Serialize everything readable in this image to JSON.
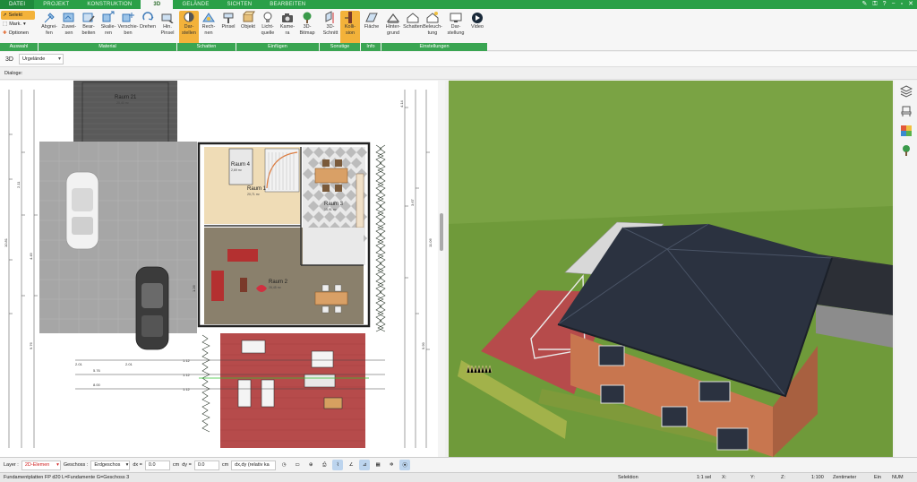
{
  "menu": {
    "tabs": [
      "DATEI",
      "PROJEKT",
      "KONSTRUKTION",
      "3D",
      "GELÄNDE",
      "SICHTEN",
      "BEARBEITEN"
    ],
    "active": "3D"
  },
  "selection": {
    "select": "Selekt",
    "mark": "Mark.",
    "options": "Optionen"
  },
  "ribbon": {
    "buttons": [
      {
        "label": "Abgrei-\nfen",
        "icon": "eyedropper-icon"
      },
      {
        "label": "Zuwei-\nsen",
        "icon": "assign-icon"
      },
      {
        "label": "Bear-\nbeiten",
        "icon": "edit-material-icon"
      },
      {
        "label": "Skalie-\nren",
        "icon": "scale-icon"
      },
      {
        "label": "Verschie-\nben",
        "icon": "move-icon"
      },
      {
        "label": "Drehen",
        "icon": "rotate-icon"
      },
      {
        "label": "Hin.\nPinsel",
        "icon": "brush-icon"
      },
      {
        "label": "Dar-\nstellen",
        "icon": "shadow-display-icon",
        "active": true
      },
      {
        "label": "Rech-\nnen",
        "icon": "calculate-icon"
      },
      {
        "label": "Pinsel",
        "icon": "paint-brush-icon"
      },
      {
        "label": "Objekt",
        "icon": "object-icon"
      },
      {
        "label": "Licht-\nquelle",
        "icon": "lightbulb-icon"
      },
      {
        "label": "Kame-\nra",
        "icon": "camera-icon"
      },
      {
        "label": "3D-\nBitmap",
        "icon": "tree-bitmap-icon"
      },
      {
        "label": "3D-\nSchnitt",
        "icon": "section-icon"
      },
      {
        "label": "Kolli-\nsion",
        "icon": "collision-icon",
        "active": true
      },
      {
        "label": "Fläche",
        "icon": "area-info-icon"
      },
      {
        "label": "Hinter-\ngrund",
        "icon": "background-icon"
      },
      {
        "label": "Schatten",
        "icon": "shadow-house-icon"
      },
      {
        "label": "Beleuch-\ntung",
        "icon": "lighting-icon"
      },
      {
        "label": "Dar-\nstellung",
        "icon": "display-monitor-icon"
      },
      {
        "label": "Video",
        "icon": "video-play-icon"
      }
    ],
    "groups": [
      "Auswahl",
      "Material",
      "Schatten",
      "Einfügen",
      "Sonstige",
      "Info",
      "Einstellungen"
    ]
  },
  "subbar": {
    "mode": "3D",
    "terrain": "Urgelände"
  },
  "dialog": {
    "label": "Dialoge:"
  },
  "plan": {
    "rooms": [
      {
        "name": "Raum 21",
        "area": "20,40 m²"
      },
      {
        "name": "Raum 4",
        "area": "2,69 m²"
      },
      {
        "name": "Raum 1",
        "area": "20,71 m²"
      },
      {
        "name": "Raum 3",
        "area": "15,91 m²"
      },
      {
        "name": "Raum 2",
        "area": "26,45 m²"
      }
    ],
    "dims": [
      "5.76",
      "8.00",
      "1.12",
      "1.12",
      "1.12",
      "2.01",
      "2.01",
      "10.81",
      "11.06",
      "2.11",
      "4.49",
      "4.14",
      "3.67",
      "1.26",
      "9.76",
      "9.99"
    ]
  },
  "bottom": {
    "layer_label": "Layer :",
    "layer_value": "2D-Elemen",
    "floor_label": "Geschoss :",
    "floor_value": "Erdgeschos",
    "dx_label": "dx =",
    "dx_value": "0.0",
    "dx_unit": "cm",
    "dy_label": "dy =",
    "dy_value": "0.0",
    "dy_unit": "cm",
    "mode_value": "dx,dy (relativ ka"
  },
  "status": {
    "left": "Fundamentplatten FP d20 L=Fundamente G=Geschoss 3",
    "mode": "Selektion",
    "sel": "1:1 sel",
    "x": "X:",
    "y": "Y:",
    "z": "Z:",
    "scale": "1:100",
    "unit": "Zentimeter",
    "ein": "Ein",
    "num": "NUM"
  },
  "colors": {
    "menu_green": "#2aa048",
    "group_green": "#3aa552",
    "active_orange": "#f3b23a",
    "terrace_red": "#b64b4b",
    "roof_dark": "#2b3240",
    "wall_brick": "#c8764f",
    "lawn": "#6f9a3a"
  }
}
